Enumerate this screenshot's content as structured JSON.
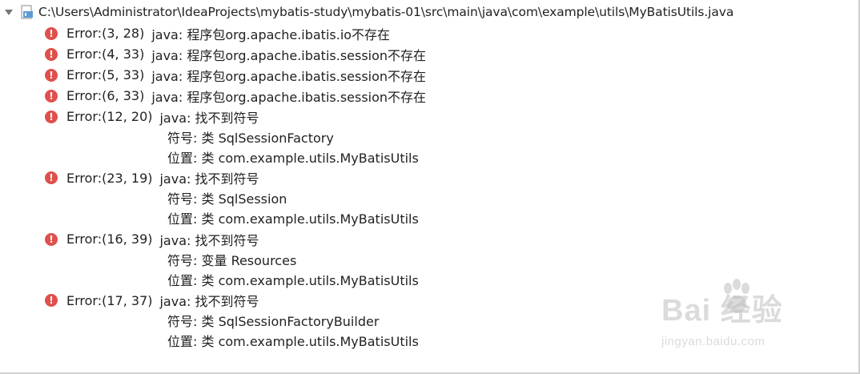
{
  "file": {
    "path": "C:\\Users\\Administrator\\IdeaProjects\\mybatis-study\\mybatis-01\\src\\main\\java\\com\\example\\utils\\MyBatisUtils.java",
    "toggle_icon": "chevron-down-icon",
    "file_icon": "java-file-icon"
  },
  "error_icon": {
    "glyph": "!",
    "color": "#e0504c"
  },
  "errors": [
    {
      "location": "Error:(3, 28)",
      "message": "java: 程序包org.apache.ibatis.io不存在",
      "details": []
    },
    {
      "location": "Error:(4, 33)",
      "message": "java: 程序包org.apache.ibatis.session不存在",
      "details": []
    },
    {
      "location": "Error:(5, 33)",
      "message": "java: 程序包org.apache.ibatis.session不存在",
      "details": []
    },
    {
      "location": "Error:(6, 33)",
      "message": "java: 程序包org.apache.ibatis.session不存在",
      "details": []
    },
    {
      "location": "Error:(12, 20)",
      "message": "java: 找不到符号",
      "details": [
        "符号:  类 SqlSessionFactory",
        "位置: 类 com.example.utils.MyBatisUtils"
      ]
    },
    {
      "location": "Error:(23, 19)",
      "message": "java: 找不到符号",
      "details": [
        "符号:  类 SqlSession",
        "位置: 类 com.example.utils.MyBatisUtils"
      ]
    },
    {
      "location": "Error:(16, 39)",
      "message": "java: 找不到符号",
      "details": [
        "符号:  变量 Resources",
        "位置: 类 com.example.utils.MyBatisUtils"
      ]
    },
    {
      "location": "Error:(17, 37)",
      "message": "java: 找不到符号",
      "details": [
        "符号:  类 SqlSessionFactoryBuilder",
        "位置: 类 com.example.utils.MyBatisUtils"
      ]
    }
  ],
  "watermark": {
    "brand": "Bai  经验",
    "url": "jingyan.baidu.com"
  }
}
